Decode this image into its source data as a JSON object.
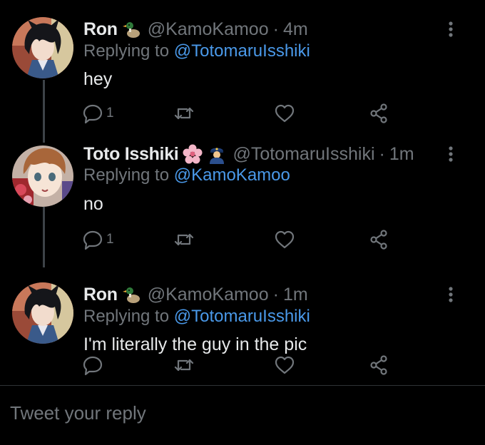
{
  "colors": {
    "background": "#000000",
    "text_primary": "#e7e9ea",
    "text_secondary": "#71767b",
    "link": "#4a99e9",
    "thread_line": "#3d4348",
    "divider": "#2f3336"
  },
  "tweets": [
    {
      "name": "Ron",
      "name_emojis": [
        "duck-emoji"
      ],
      "handle": "@KamoKamoo",
      "separator": "·",
      "time": "4m",
      "replying_prefix": "Replying to",
      "replying_to": "@TotomaruIsshiki",
      "text": "hey",
      "reply_count": "1",
      "retweet_count": "",
      "like_count": ""
    },
    {
      "name": "Toto Isshiki",
      "name_emojis": [
        "cherry-blossom-emoji",
        "police-officer-emoji"
      ],
      "handle": "@TotomaruIsshiki",
      "separator": "·",
      "time": "1m",
      "replying_prefix": "Replying to",
      "replying_to": "@KamoKamoo",
      "text": "no",
      "reply_count": "1",
      "retweet_count": "",
      "like_count": ""
    },
    {
      "name": "Ron",
      "name_emojis": [
        "duck-emoji"
      ],
      "handle": "@KamoKamoo",
      "separator": "·",
      "time": "1m",
      "replying_prefix": "Replying to",
      "replying_to": "@TotomaruIsshiki",
      "text": "I'm literally the guy in the pic",
      "reply_count": "",
      "retweet_count": "",
      "like_count": ""
    }
  ],
  "composer": {
    "placeholder": "Tweet your reply"
  },
  "icons": {
    "reply": "reply-icon",
    "retweet": "retweet-icon",
    "like": "like-icon",
    "share": "share-icon",
    "more": "more-options-icon"
  }
}
